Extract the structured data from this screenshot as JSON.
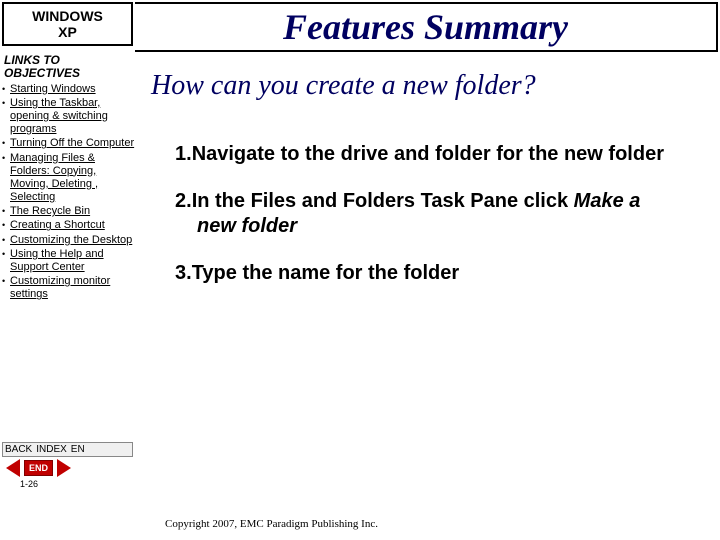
{
  "sidebar": {
    "logo_line1": "WINDOWS",
    "logo_line2": "XP",
    "heading": "LINKS TO OBJECTIVES",
    "items": [
      "Starting Windows",
      "Using the Taskbar, opening & switching programs",
      "Turning Off the Computer",
      "Managing Files & Folders: Copying, Moving, Deleting , Selecting",
      "The Recycle Bin",
      "Creating a Shortcut",
      "Customizing the Desktop",
      "Using the Help and Support Center",
      "Customizing monitor settings"
    ]
  },
  "overlay": {
    "label_back": "BACK",
    "label_index": "INDEX",
    "label_en": "EN",
    "end_label": "END",
    "slide_num": "1-26"
  },
  "main": {
    "title": "Features Summary",
    "question": "How can you create a new folder?",
    "steps": [
      {
        "num": "1.",
        "text_before": "Navigate to the drive and folder for the new folder",
        "emph": "",
        "text_after": ""
      },
      {
        "num": "2.",
        "text_before": "In the Files and Folders Task Pane click ",
        "emph": "Make a new folder",
        "text_after": ""
      },
      {
        "num": "3.",
        "text_before": "Type the name for the folder",
        "emph": "",
        "text_after": ""
      }
    ],
    "copyright": "Copyright 2007, EMC Paradigm Publishing Inc."
  }
}
